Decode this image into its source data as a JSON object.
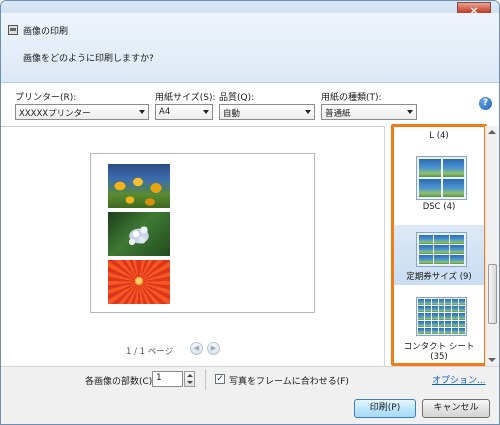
{
  "window": {
    "title": "画像の印刷",
    "close_glyph": "×"
  },
  "instruction": "画像をどのように印刷しますか?",
  "options": {
    "printer": {
      "label": "プリンター(R):",
      "value": "XXXXXプリンター"
    },
    "paper_size": {
      "label": "用紙サイズ(S):",
      "value": "A4"
    },
    "quality": {
      "label": "品質(Q):",
      "value": "自動"
    },
    "paper_type": {
      "label": "用紙の種類(T):",
      "value": "普通紙"
    }
  },
  "help_glyph": "?",
  "preview": {
    "page_indicator": "1 / 1 ページ",
    "prev_glyph": "◀",
    "next_glyph": "▶"
  },
  "layouts": [
    {
      "label": "L (4)",
      "selected": false
    },
    {
      "label": "DSC (4)",
      "selected": false
    },
    {
      "label": "定期券サイズ (9)",
      "selected": true
    },
    {
      "label": "コンタクト シート (35)",
      "selected": false
    }
  ],
  "bottom": {
    "copies_label": "各画像の部数(C):",
    "copies_value": "1",
    "fit_checked": true,
    "fit_mark": "✓",
    "fit_label": "写真をフレームに合わせる(F)",
    "options_link": "オプション..."
  },
  "buttons": {
    "print": "印刷(P)",
    "cancel": "キャンセル"
  },
  "colors": {
    "highlight": "#f07c16",
    "link": "#0b5fc9"
  }
}
